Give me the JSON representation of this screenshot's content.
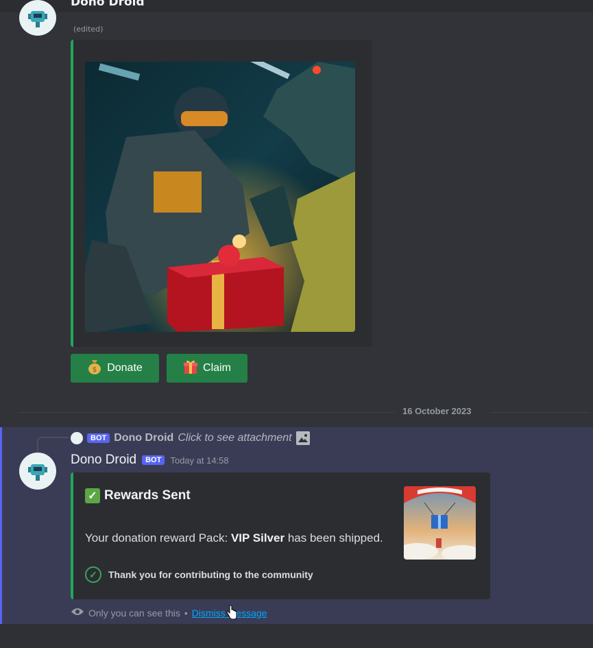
{
  "message1": {
    "author": "Dono Droid",
    "edited_label": "(edited)",
    "buttons": [
      {
        "label": "Donate",
        "emoji": "money-bag-icon"
      },
      {
        "label": "Claim",
        "emoji": "gift-icon"
      }
    ]
  },
  "divider": {
    "date": "16 October 2023"
  },
  "message2": {
    "reply": {
      "bot_tag": "BOT",
      "author": "Dono Droid",
      "text": "Click to see attachment"
    },
    "author": "Dono Droid",
    "bot_tag": "BOT",
    "timestamp": "Today at 14:58",
    "embed": {
      "check_emoji": "✓",
      "title": "Rewards Sent",
      "desc_prefix": "Your donation reward Pack: ",
      "desc_bold": "VIP Silver",
      "desc_suffix": " has been shipped.",
      "footer": "Thank you for contributing to the community"
    },
    "ephemeral": {
      "note": "Only you can see this",
      "separator": "•",
      "dismiss": "Dismiss message"
    }
  },
  "colors": {
    "background": "#313338",
    "embed_bg": "#2b2d31",
    "button_green": "#248046",
    "embed_border": "#23a55a",
    "bot_tag": "#5865f2",
    "highlight": "#3a3c56",
    "link": "#00a8fc"
  }
}
